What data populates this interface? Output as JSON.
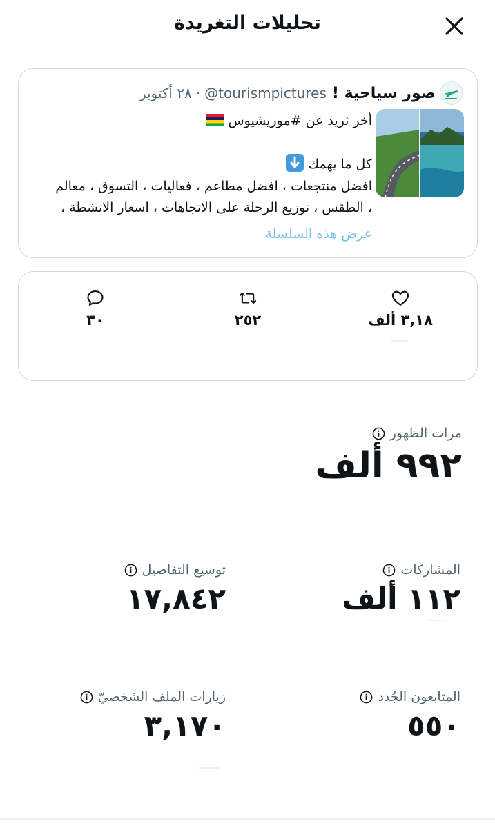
{
  "header": {
    "title": "تحليلات التغريدة",
    "close_icon": "close-icon"
  },
  "tweet": {
    "author_name": "صور سياحية !",
    "handle": "@tourismpictures",
    "separator": "·",
    "date": "٢٨ أكتوبر",
    "lines": [
      "أخر ثريد عن #موريشيوس",
      "",
      "كل ما يهمك",
      "افضل منتجعات ، افضل مطاعم ، فعاليات ، التسوق ، معالم",
      "، الطقس ، توزيع الرحلة على الاتجاهات ، اسعار الانشطة ،"
    ],
    "show_thread": "عرض هذه السلسلة"
  },
  "engagement": {
    "likes": "٣,١٨ ألف",
    "retweets": "٢٥٢",
    "replies": "٣٠"
  },
  "metrics": {
    "impressions": {
      "label": "مرات الظهور",
      "value": "٩٩٢ ألف"
    },
    "engagements": {
      "label": "المشاركات",
      "value": "١١٢ ألف"
    },
    "detail_expands": {
      "label": "توسيع التفاصيل",
      "value": "١٧,٨٤٢"
    },
    "new_followers": {
      "label": "المتابعون الجُدد",
      "value": "٥٥٠"
    },
    "profile_visits": {
      "label": "زيارات الملف الشخصيّ",
      "value": "٣,١٧٠"
    }
  },
  "colors": {
    "accent": "#1d9bf0",
    "text": "#0f1419",
    "muted": "#536471",
    "border": "#cfd9de"
  }
}
